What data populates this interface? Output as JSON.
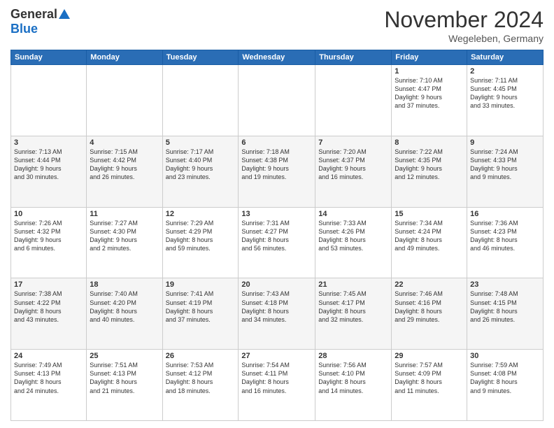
{
  "header": {
    "logo_general": "General",
    "logo_blue": "Blue",
    "month_title": "November 2024",
    "location": "Wegeleben, Germany"
  },
  "calendar": {
    "headers": [
      "Sunday",
      "Monday",
      "Tuesday",
      "Wednesday",
      "Thursday",
      "Friday",
      "Saturday"
    ],
    "weeks": [
      [
        {
          "day": "",
          "info": ""
        },
        {
          "day": "",
          "info": ""
        },
        {
          "day": "",
          "info": ""
        },
        {
          "day": "",
          "info": ""
        },
        {
          "day": "",
          "info": ""
        },
        {
          "day": "1",
          "info": "Sunrise: 7:10 AM\nSunset: 4:47 PM\nDaylight: 9 hours\nand 37 minutes."
        },
        {
          "day": "2",
          "info": "Sunrise: 7:11 AM\nSunset: 4:45 PM\nDaylight: 9 hours\nand 33 minutes."
        }
      ],
      [
        {
          "day": "3",
          "info": "Sunrise: 7:13 AM\nSunset: 4:44 PM\nDaylight: 9 hours\nand 30 minutes."
        },
        {
          "day": "4",
          "info": "Sunrise: 7:15 AM\nSunset: 4:42 PM\nDaylight: 9 hours\nand 26 minutes."
        },
        {
          "day": "5",
          "info": "Sunrise: 7:17 AM\nSunset: 4:40 PM\nDaylight: 9 hours\nand 23 minutes."
        },
        {
          "day": "6",
          "info": "Sunrise: 7:18 AM\nSunset: 4:38 PM\nDaylight: 9 hours\nand 19 minutes."
        },
        {
          "day": "7",
          "info": "Sunrise: 7:20 AM\nSunset: 4:37 PM\nDaylight: 9 hours\nand 16 minutes."
        },
        {
          "day": "8",
          "info": "Sunrise: 7:22 AM\nSunset: 4:35 PM\nDaylight: 9 hours\nand 12 minutes."
        },
        {
          "day": "9",
          "info": "Sunrise: 7:24 AM\nSunset: 4:33 PM\nDaylight: 9 hours\nand 9 minutes."
        }
      ],
      [
        {
          "day": "10",
          "info": "Sunrise: 7:26 AM\nSunset: 4:32 PM\nDaylight: 9 hours\nand 6 minutes."
        },
        {
          "day": "11",
          "info": "Sunrise: 7:27 AM\nSunset: 4:30 PM\nDaylight: 9 hours\nand 2 minutes."
        },
        {
          "day": "12",
          "info": "Sunrise: 7:29 AM\nSunset: 4:29 PM\nDaylight: 8 hours\nand 59 minutes."
        },
        {
          "day": "13",
          "info": "Sunrise: 7:31 AM\nSunset: 4:27 PM\nDaylight: 8 hours\nand 56 minutes."
        },
        {
          "day": "14",
          "info": "Sunrise: 7:33 AM\nSunset: 4:26 PM\nDaylight: 8 hours\nand 53 minutes."
        },
        {
          "day": "15",
          "info": "Sunrise: 7:34 AM\nSunset: 4:24 PM\nDaylight: 8 hours\nand 49 minutes."
        },
        {
          "day": "16",
          "info": "Sunrise: 7:36 AM\nSunset: 4:23 PM\nDaylight: 8 hours\nand 46 minutes."
        }
      ],
      [
        {
          "day": "17",
          "info": "Sunrise: 7:38 AM\nSunset: 4:22 PM\nDaylight: 8 hours\nand 43 minutes."
        },
        {
          "day": "18",
          "info": "Sunrise: 7:40 AM\nSunset: 4:20 PM\nDaylight: 8 hours\nand 40 minutes."
        },
        {
          "day": "19",
          "info": "Sunrise: 7:41 AM\nSunset: 4:19 PM\nDaylight: 8 hours\nand 37 minutes."
        },
        {
          "day": "20",
          "info": "Sunrise: 7:43 AM\nSunset: 4:18 PM\nDaylight: 8 hours\nand 34 minutes."
        },
        {
          "day": "21",
          "info": "Sunrise: 7:45 AM\nSunset: 4:17 PM\nDaylight: 8 hours\nand 32 minutes."
        },
        {
          "day": "22",
          "info": "Sunrise: 7:46 AM\nSunset: 4:16 PM\nDaylight: 8 hours\nand 29 minutes."
        },
        {
          "day": "23",
          "info": "Sunrise: 7:48 AM\nSunset: 4:15 PM\nDaylight: 8 hours\nand 26 minutes."
        }
      ],
      [
        {
          "day": "24",
          "info": "Sunrise: 7:49 AM\nSunset: 4:13 PM\nDaylight: 8 hours\nand 24 minutes."
        },
        {
          "day": "25",
          "info": "Sunrise: 7:51 AM\nSunset: 4:13 PM\nDaylight: 8 hours\nand 21 minutes."
        },
        {
          "day": "26",
          "info": "Sunrise: 7:53 AM\nSunset: 4:12 PM\nDaylight: 8 hours\nand 18 minutes."
        },
        {
          "day": "27",
          "info": "Sunrise: 7:54 AM\nSunset: 4:11 PM\nDaylight: 8 hours\nand 16 minutes."
        },
        {
          "day": "28",
          "info": "Sunrise: 7:56 AM\nSunset: 4:10 PM\nDaylight: 8 hours\nand 14 minutes."
        },
        {
          "day": "29",
          "info": "Sunrise: 7:57 AM\nSunset: 4:09 PM\nDaylight: 8 hours\nand 11 minutes."
        },
        {
          "day": "30",
          "info": "Sunrise: 7:59 AM\nSunset: 4:08 PM\nDaylight: 8 hours\nand 9 minutes."
        }
      ]
    ]
  }
}
